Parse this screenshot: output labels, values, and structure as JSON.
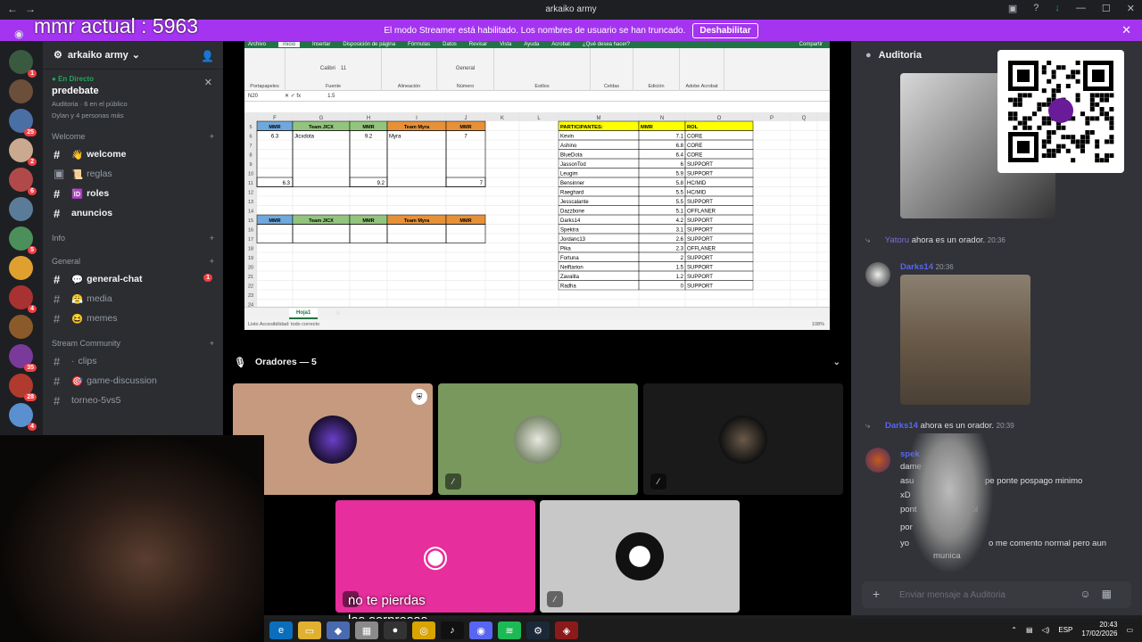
{
  "window": {
    "title": "arkaiko army"
  },
  "overlay": {
    "mmr": "mmr actual : 5963",
    "caption_line1": "no te pierdas",
    "caption_line2": "las sorpresas"
  },
  "streamer_banner": {
    "text": "El modo Streamer está habilitado. Los nombres de usuario se han truncado.",
    "button": "Deshabilitar"
  },
  "servers": [
    {
      "color": "#3a5a40",
      "badge": "1"
    },
    {
      "color": "#6b4f3a",
      "badge": ""
    },
    {
      "color": "#4a6fa5",
      "badge": "25"
    },
    {
      "color": "#c9a98f",
      "badge": "2"
    },
    {
      "color": "#b04a4a",
      "badge": "6"
    },
    {
      "color": "#5b7c99",
      "badge": ""
    },
    {
      "color": "#4b8f5b",
      "badge": "5"
    },
    {
      "color": "#e0a030",
      "badge": ""
    },
    {
      "color": "#a83232",
      "badge": "4"
    },
    {
      "color": "#8a5a2b",
      "badge": ""
    },
    {
      "color": "#7a3a9a",
      "badge": "35"
    },
    {
      "color": "#b03a2e",
      "badge": "28"
    },
    {
      "color": "#5a8fd0",
      "badge": "4"
    }
  ],
  "guild": {
    "name": "arkaiko army",
    "live_label": "En Directo",
    "room": "predebate",
    "room_meta": "Auditoria  ·  6 en el público",
    "room_people": "Dylan y 4 personas más"
  },
  "categories": {
    "welcome": "Welcome",
    "info": "Info",
    "general": "General",
    "stream": "Stream Community"
  },
  "channels": {
    "welcome": "welcome",
    "reglas": "reglas",
    "roles": "roles",
    "anuncios": "anuncios",
    "general_chat": "general-chat",
    "general_chat_badge": "1",
    "media": "media",
    "memes": "memes",
    "clips": "clips",
    "game_discussion": "game-discussion",
    "torneo": "torneo-5vs5"
  },
  "excel": {
    "tabs": [
      "Archivo",
      "Inicio",
      "Insertar",
      "Disposición de página",
      "Fórmulas",
      "Datos",
      "Revisar",
      "Vista",
      "Ayuda",
      "Acrobat",
      "¿Qué desea hacer?"
    ],
    "share": "Compartir",
    "font": "Calibri",
    "size": "11",
    "format": "General",
    "groups": [
      "Portapapeles",
      "Fuente",
      "Alineación",
      "Número",
      "Estilos",
      "Celdas",
      "Edición",
      "Adobe Acrobat"
    ],
    "namebox": "N20",
    "formula": "1.5",
    "columns": [
      "F",
      "G",
      "H",
      "I",
      "J",
      "K",
      "L",
      "M",
      "N",
      "O",
      "P",
      "Q"
    ],
    "rows": [
      "5",
      "6",
      "7",
      "8",
      "9",
      "10",
      "11",
      "12",
      "13",
      "14",
      "15",
      "16",
      "17",
      "18",
      "19",
      "20",
      "21",
      "22",
      "23",
      "24"
    ],
    "team_headers": [
      "MMR",
      "Team JICX",
      "MMR",
      "Team Myra",
      "MMR"
    ],
    "team_row6": [
      "6.3",
      "Jicxdota",
      "9.2",
      "Myra",
      "7"
    ],
    "team_row11": [
      "6.3",
      "9.2",
      "7"
    ],
    "participants_headers": [
      "PARTICIPANTES:",
      "MMR",
      "ROL"
    ],
    "participants": [
      [
        "Kevin",
        "7.1",
        "CORE"
      ],
      [
        "Ashino",
        "6.8",
        "CORE"
      ],
      [
        "BlueDota",
        "6.4",
        "CORE"
      ],
      [
        "JassonTod",
        "6",
        "SUPPORT"
      ],
      [
        "Leugim",
        "5.9",
        "SUPPORT"
      ],
      [
        "Bensinner",
        "5.8",
        "HC/MID"
      ],
      [
        "Raeghard",
        "5.5",
        "HC/MID"
      ],
      [
        "Jesscalante",
        "5.5",
        "SUPPORT"
      ],
      [
        "Dazzbone",
        "5.1",
        "OFFLANER"
      ],
      [
        "Darks14",
        "4.2",
        "SUPPORT"
      ],
      [
        "Spektra",
        "3.1",
        "SUPPORT"
      ],
      [
        "Jordanc13",
        "2.6",
        "SUPPORT"
      ],
      [
        "Pika",
        "2.3",
        "OFFLANER"
      ],
      [
        "Fortuna",
        "2",
        "SUPPORT"
      ],
      [
        "Nelftarion",
        "1.5",
        "SUPPORT"
      ],
      [
        "Zavalita",
        "1.2",
        "SUPPORT"
      ],
      [
        "Radha",
        "0",
        "SUPPORT"
      ]
    ],
    "sheet_tab": "Hoja1",
    "status": "Listo    Accesibilidad: todo correcto",
    "zoom": "108%"
  },
  "stage": {
    "speakers_label": "Oradores — 5"
  },
  "right_panel": {
    "title": "Auditoria",
    "msg1_user": "Yatoru",
    "msg1_text": "ahora es un orador.",
    "msg1_time": "20:36",
    "msg2_user": "Darks14",
    "msg2_time": "20:36",
    "msg3_user": "Darks14",
    "msg3_text": "ahora es un orador.",
    "msg3_time": "20:39",
    "msg4_user": "spek",
    "lines": [
      "dame",
      "asu",
      "xD",
      "pont",
      "por",
      "yo"
    ],
    "lines_tail": [
      "pe ponte pospago minimo",
      "sol",
      "o me comento normal pero aun",
      "munica"
    ],
    "placeholder": "Enviar mensaje a Auditoria"
  },
  "taskbar": {
    "lang": "ESP",
    "time": "20:43",
    "date": "17/02/2026"
  }
}
